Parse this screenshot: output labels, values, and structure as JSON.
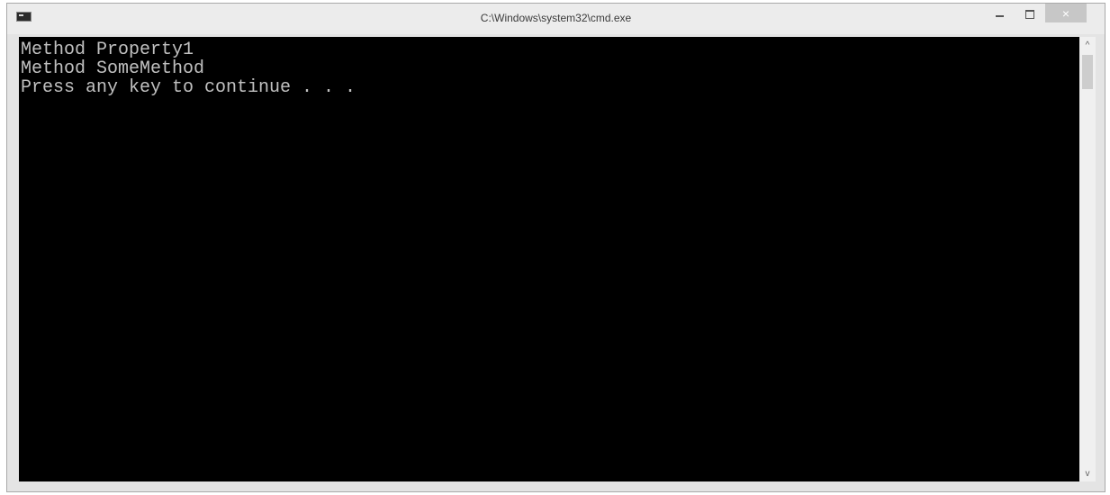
{
  "window": {
    "title": "C:\\Windows\\system32\\cmd.exe",
    "icon": "cmd-icon",
    "controls": {
      "minimize": "minimize-icon",
      "maximize": "maximize-icon",
      "close_label": "×"
    }
  },
  "console": {
    "lines": [
      "Method Property1",
      "Method SomeMethod",
      "Press any key to continue . . ."
    ],
    "background": "#000000",
    "foreground": "#c0c0c0"
  },
  "scrollbar": {
    "up_arrow": "^",
    "down_arrow": "v"
  }
}
